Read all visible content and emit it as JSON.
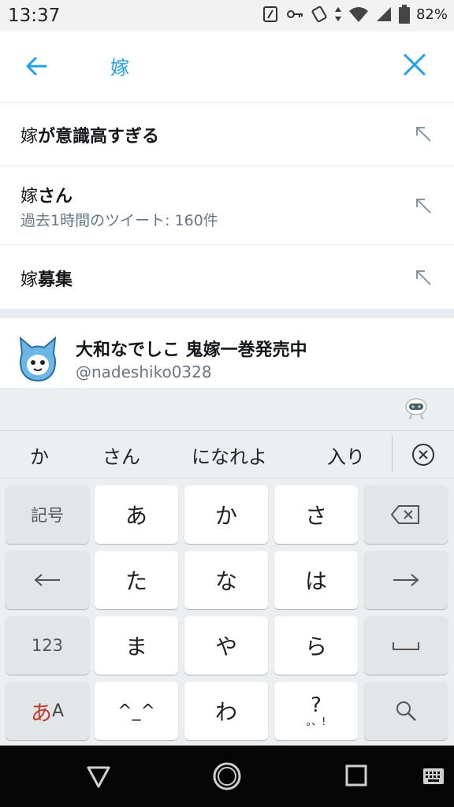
{
  "status_bar": {
    "time": "13:37",
    "battery": "82%"
  },
  "search": {
    "query": "嫁"
  },
  "suggestions": [
    {
      "prefix": "嫁",
      "rest": "が意識高すぎる",
      "sub": ""
    },
    {
      "prefix": "嫁",
      "rest": "さん",
      "sub": "過去1時間のツイート: 160件"
    },
    {
      "prefix": "嫁",
      "rest": "募集",
      "sub": ""
    }
  ],
  "account": {
    "name": "大和なでしこ 鬼嫁一巻発売中",
    "handle": "@nadeshiko0328"
  },
  "keyboard": {
    "candidates": [
      "か",
      "さん",
      "になれよ",
      "入り"
    ],
    "row1": [
      "記号",
      "あ",
      "か",
      "さ"
    ],
    "row2": [
      "た",
      "な",
      "は"
    ],
    "row3": [
      "123",
      "ま",
      "や",
      "ら"
    ],
    "row4": [
      "^_^",
      "わ",
      "?",
      "。、!"
    ],
    "lang_a": "あ",
    "lang_b": "A"
  },
  "colors": {
    "accent": "#1da1f2",
    "secondary_text": "#657786",
    "lang_key": "#c0392b"
  }
}
